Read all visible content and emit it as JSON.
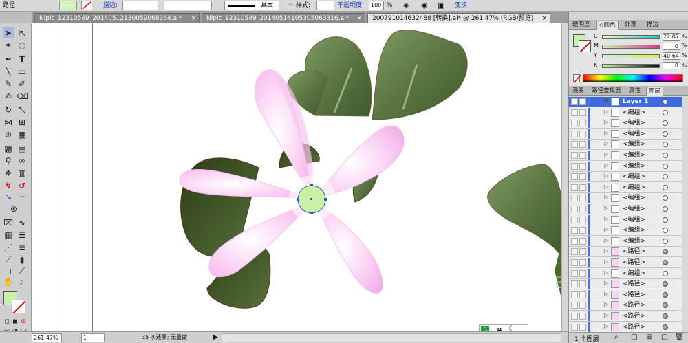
{
  "control_bar": {
    "object_label": "路径",
    "stroke_label": "描边:",
    "style_line_label": "基本",
    "style_label": "样式:",
    "opacity_label": "不透明度:",
    "opacity_value": "100",
    "opacity_unit": "%",
    "transform_label": "变换"
  },
  "tabs": [
    {
      "label": "Nipic_12310549_20140512130059068364.ai*",
      "close": "×"
    },
    {
      "label": "Nipic_12310549_20140514105305063316.ai*",
      "close": "×"
    },
    {
      "label": "200791014632488 [转换].ai* @ 261.47% (RGB/预览)",
      "close": "×"
    }
  ],
  "color_panel": {
    "tabs": [
      "透明度",
      "颜色",
      "外观",
      "描边"
    ],
    "channels": [
      {
        "name": "C",
        "value": "22.07",
        "unit": "%"
      },
      {
        "name": "M",
        "value": "0",
        "unit": "%"
      },
      {
        "name": "Y",
        "value": "40.64",
        "unit": "%"
      },
      {
        "name": "K",
        "value": "0",
        "unit": "%"
      }
    ],
    "fill_color": "#c8f0a8"
  },
  "layers_panel": {
    "tabs": [
      "渐变",
      "路径查找器",
      "属性",
      "图层"
    ],
    "rows": [
      {
        "name": "Layer 1",
        "selected": true,
        "filled_target": false
      },
      {
        "name": "<编组>",
        "filled_target": false
      },
      {
        "name": "<编组>",
        "filled_target": false
      },
      {
        "name": "<编组>",
        "filled_target": false
      },
      {
        "name": "<编组>",
        "filled_target": false
      },
      {
        "name": "<编组>",
        "filled_target": false
      },
      {
        "name": "<编组>",
        "filled_target": false
      },
      {
        "name": "<编组>",
        "filled_target": false
      },
      {
        "name": "<编组>",
        "filled_target": false
      },
      {
        "name": "<编组>",
        "filled_target": false
      },
      {
        "name": "<编组>",
        "filled_target": false
      },
      {
        "name": "<编组>",
        "filled_target": false
      },
      {
        "name": "<编组>",
        "filled_target": false
      },
      {
        "name": "<编组>",
        "filled_target": false
      },
      {
        "name": "<路径>",
        "filled_target": true
      },
      {
        "name": "<路径>",
        "filled_target": true
      },
      {
        "name": "<编组>",
        "filled_target": false
      },
      {
        "name": "<路径>",
        "filled_target": true
      },
      {
        "name": "<路径>",
        "filled_target": true
      },
      {
        "name": "<路径>",
        "filled_target": true
      },
      {
        "name": "<路径>",
        "filled_target": true
      },
      {
        "name": "<路径>",
        "filled_target": true
      }
    ],
    "footer": "1 个图层"
  },
  "status_bar": {
    "zoom": "261.47%",
    "page": "1",
    "history": "35 次还原; 无重做"
  },
  "ime": {
    "label": "英"
  },
  "watermark": "Baidu 经验 jingyan.baidu.com"
}
